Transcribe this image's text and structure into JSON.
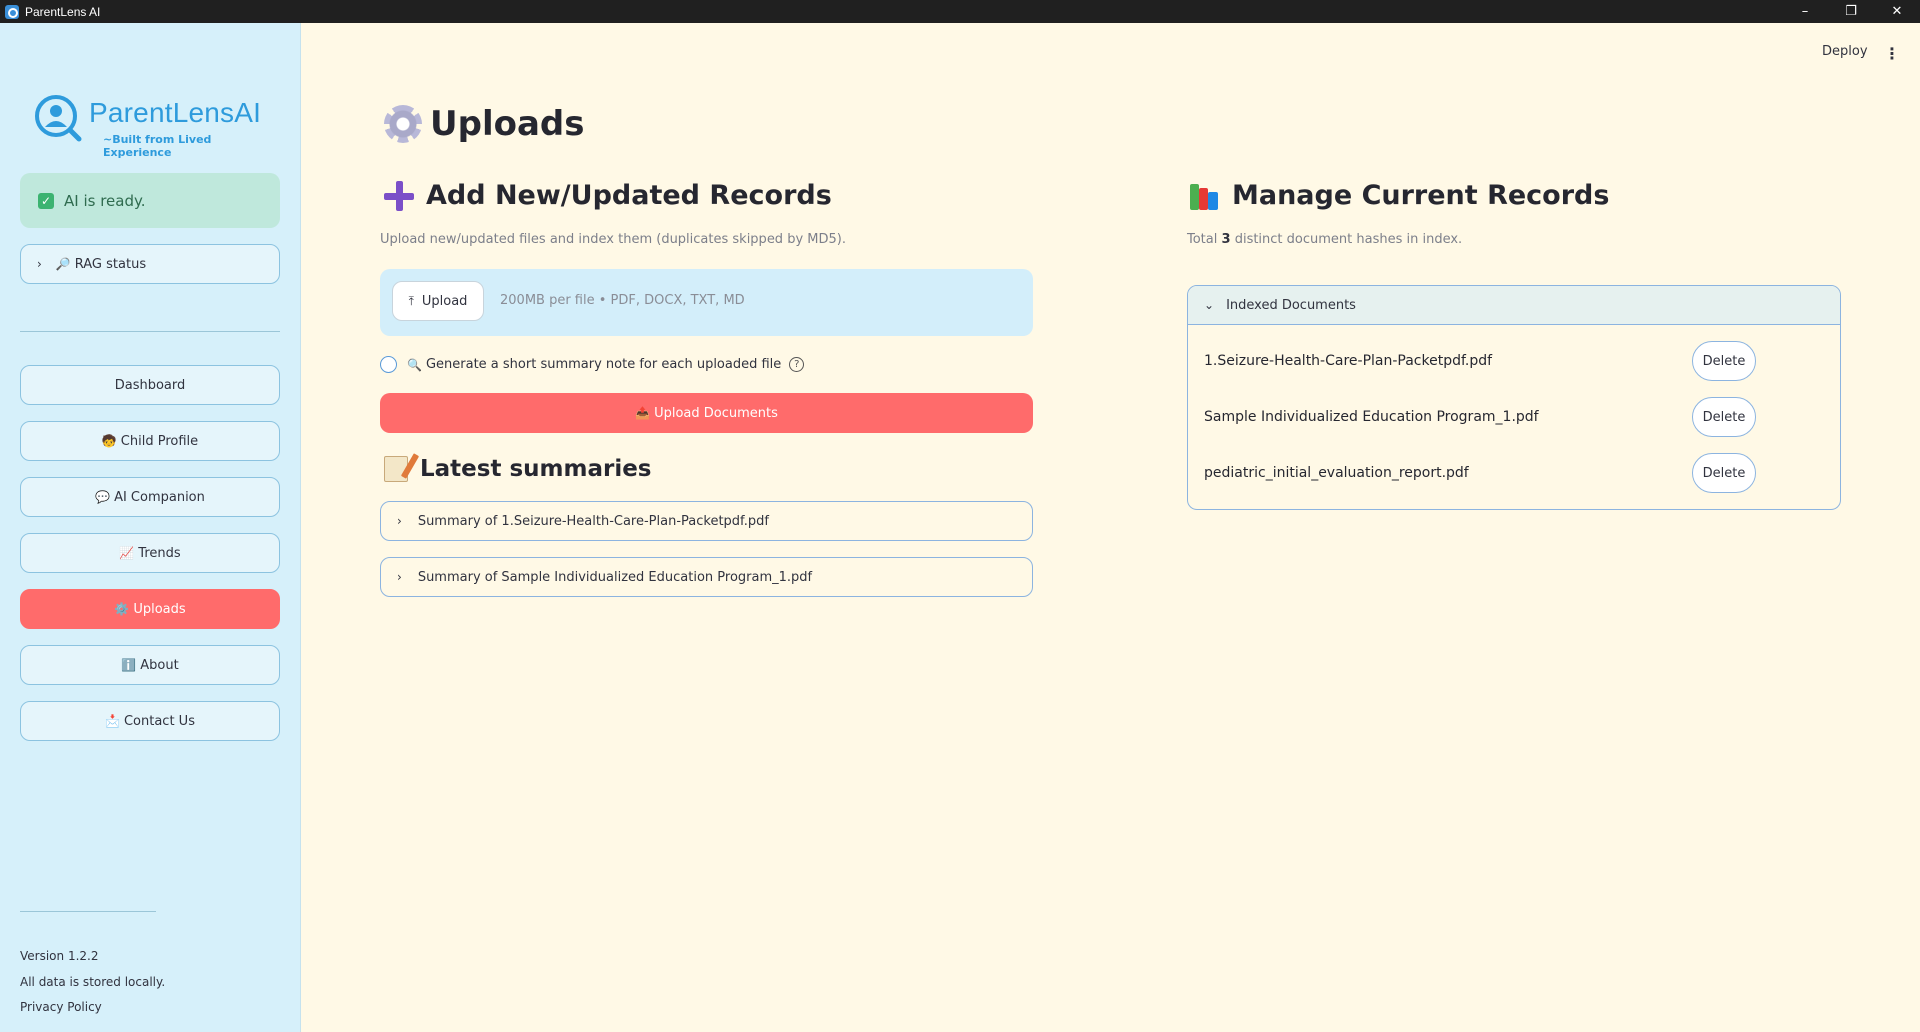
{
  "window": {
    "title": "ParentLens AI",
    "controls": {
      "minimize": "–",
      "restore": "❐",
      "close": "✕"
    }
  },
  "sidebar": {
    "logo": {
      "name": "ParentLensAI",
      "tagline": "~Built from Lived Experience"
    },
    "ai_status": "AI is ready.",
    "rag_status": {
      "label": "RAG status",
      "icon": "🔎"
    },
    "nav": [
      {
        "label": "Dashboard",
        "icon": ""
      },
      {
        "label": "Child Profile",
        "icon": "🧒"
      },
      {
        "label": "AI Companion",
        "icon": "💬"
      },
      {
        "label": "Trends",
        "icon": "📈"
      },
      {
        "label": "Uploads",
        "icon": "⚙️",
        "active": true
      },
      {
        "label": "About",
        "icon": "ℹ️"
      },
      {
        "label": "Contact Us",
        "icon": "📩"
      }
    ],
    "footer": {
      "version": "Version 1.2.2",
      "storage": "All data is stored locally.",
      "privacy": "Privacy Policy"
    }
  },
  "header": {
    "deploy": "Deploy",
    "menu": "⋮"
  },
  "main": {
    "title": "Uploads",
    "add_section": {
      "title": "Add New/Updated Records",
      "caption": "Upload new/updated files and index them (duplicates skipped by MD5).",
      "upload_button": "Upload",
      "drop_hint": "200MB per file • PDF, DOCX, TXT, MD",
      "summary_option": "Generate a short summary note for each uploaded file",
      "summary_icon": "🔍",
      "submit_button": "Upload Documents",
      "submit_icon": "📤"
    },
    "summaries": {
      "title": "Latest summaries",
      "items": [
        "Summary of 1.Seizure-Health-Care-Plan-Packetpdf.pdf",
        "Summary of Sample Individualized Education Program_1.pdf"
      ]
    },
    "manage_section": {
      "title": "Manage Current Records",
      "caption_prefix": "Total",
      "count": "3",
      "caption_suffix": "distinct document hashes in index.",
      "panel_title": "Indexed Documents",
      "delete_label": "Delete",
      "documents": [
        "1.Seizure-Health-Care-Plan-Packetpdf.pdf",
        "Sample Individualized Education Program_1.pdf",
        "pediatric_initial_evaluation_report.pdf"
      ]
    }
  },
  "colors": {
    "sidebar_bg": "#d6f0fa",
    "main_bg": "#fff9e6",
    "accent": "#ff6b6b",
    "brand": "#2e9bdc"
  }
}
